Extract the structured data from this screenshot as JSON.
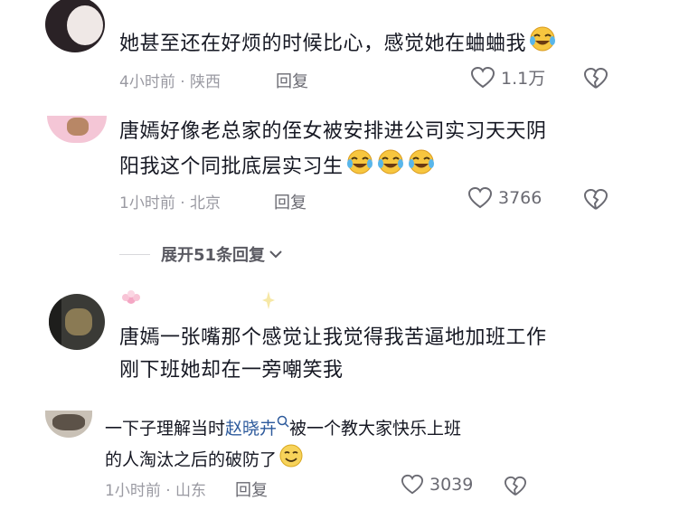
{
  "comments": [
    {
      "text": "她甚至还在好烦的时候比心，感觉她在蛐蛐我",
      "time": "4小时前",
      "location": "陕西",
      "reply": "回复",
      "likes": "1.1万"
    },
    {
      "text_line1": "唐嫣好像老总家的侄女被安排进公司实习天天阴",
      "text_line2": "阳我这个同批底层实习生",
      "time": "1小时前",
      "location": "北京",
      "reply": "回复",
      "likes": "3766",
      "expand": "展开51条回复"
    },
    {
      "text_line1": "唐嫣一张嘴那个感觉让我觉得我苦逼地加班工作",
      "text_line2": "刚下班她却在一旁嘲笑我"
    },
    {
      "text_part1": "一下子理解当时",
      "mention": "赵晓卉",
      "text_part2": "被一个教大家快乐上班",
      "text_line2": "的人淘汰之后的破防了",
      "time": "1小时前",
      "location": "山东",
      "reply": "回复",
      "likes": "3039"
    }
  ],
  "colors": {
    "text": "#161823",
    "meta": "#9a9aa2",
    "mention": "#2d5a9c"
  },
  "icons": [
    "heart-outline-icon",
    "broken-heart-icon",
    "laugh-cry-emoji",
    "smile-emoji",
    "search-mini-icon",
    "chevron-down-icon"
  ]
}
